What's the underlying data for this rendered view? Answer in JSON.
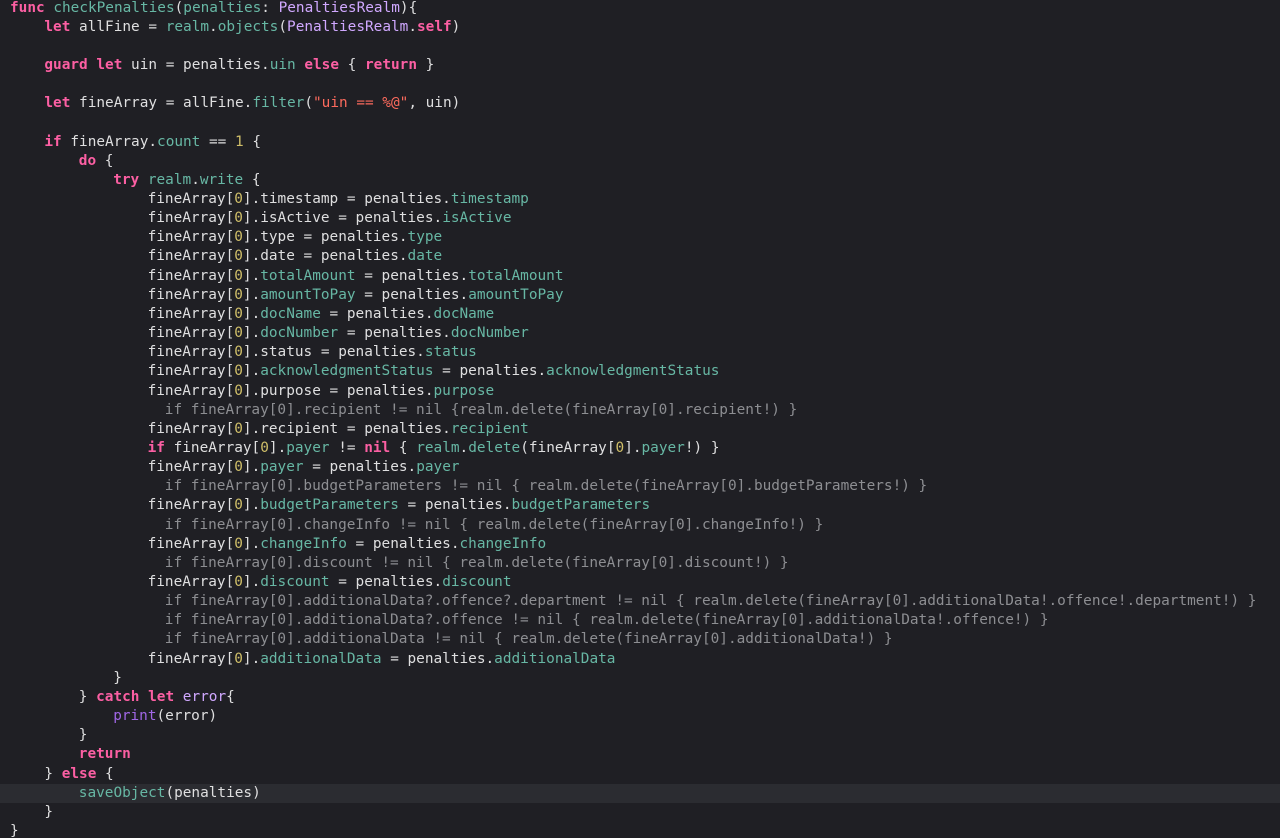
{
  "editor": {
    "theme_colors": {
      "background": "#1f1f24",
      "current_line": "#2b2c31",
      "keyword": "#fc5fa3",
      "method": "#67b7a4",
      "type": "#d0a8ff",
      "string": "#fc6a5d",
      "number": "#d0bf69",
      "plain": "#dfdfe0",
      "builtin": "#a167e6",
      "disabled": "#8d8e92"
    },
    "current_line_index": 41,
    "lines": [
      {
        "indent": 0,
        "tokens": [
          {
            "t": "func",
            "c": "kw"
          },
          {
            "t": " ",
            "c": "pl"
          },
          {
            "t": "checkPenalties",
            "c": "fn"
          },
          {
            "t": "(",
            "c": "pl"
          },
          {
            "t": "penalties",
            "c": "fn"
          },
          {
            "t": ": ",
            "c": "pl"
          },
          {
            "t": "PenaltiesRealm",
            "c": "typ"
          },
          {
            "t": "){",
            "c": "pl"
          }
        ]
      },
      {
        "indent": 4,
        "tokens": [
          {
            "t": "let",
            "c": "kw"
          },
          {
            "t": " allFine = ",
            "c": "pl"
          },
          {
            "t": "realm",
            "c": "prop"
          },
          {
            "t": ".",
            "c": "pl"
          },
          {
            "t": "objects",
            "c": "fn"
          },
          {
            "t": "(",
            "c": "pl"
          },
          {
            "t": "PenaltiesRealm",
            "c": "typ"
          },
          {
            "t": ".",
            "c": "pl"
          },
          {
            "t": "self",
            "c": "kw"
          },
          {
            "t": ")",
            "c": "pl"
          }
        ]
      },
      {
        "indent": 0,
        "tokens": []
      },
      {
        "indent": 4,
        "tokens": [
          {
            "t": "guard",
            "c": "kw"
          },
          {
            "t": " ",
            "c": "pl"
          },
          {
            "t": "let",
            "c": "kw"
          },
          {
            "t": " uin = penalties.",
            "c": "pl"
          },
          {
            "t": "uin",
            "c": "prop"
          },
          {
            "t": " ",
            "c": "pl"
          },
          {
            "t": "else",
            "c": "kw"
          },
          {
            "t": " { ",
            "c": "pl"
          },
          {
            "t": "return",
            "c": "kw"
          },
          {
            "t": " }",
            "c": "pl"
          }
        ]
      },
      {
        "indent": 0,
        "tokens": []
      },
      {
        "indent": 4,
        "tokens": [
          {
            "t": "let",
            "c": "kw"
          },
          {
            "t": " fineArray = allFine.",
            "c": "pl"
          },
          {
            "t": "filter",
            "c": "fn"
          },
          {
            "t": "(",
            "c": "pl"
          },
          {
            "t": "\"uin == %@\"",
            "c": "str"
          },
          {
            "t": ", uin)",
            "c": "pl"
          }
        ]
      },
      {
        "indent": 0,
        "tokens": []
      },
      {
        "indent": 4,
        "tokens": [
          {
            "t": "if",
            "c": "kw"
          },
          {
            "t": " fineArray.",
            "c": "pl"
          },
          {
            "t": "count",
            "c": "prop"
          },
          {
            "t": " == ",
            "c": "pl"
          },
          {
            "t": "1",
            "c": "num"
          },
          {
            "t": " {",
            "c": "pl"
          }
        ]
      },
      {
        "indent": 8,
        "tokens": [
          {
            "t": "do",
            "c": "kw"
          },
          {
            "t": " {",
            "c": "pl"
          }
        ]
      },
      {
        "indent": 12,
        "tokens": [
          {
            "t": "try",
            "c": "kw"
          },
          {
            "t": " ",
            "c": "pl"
          },
          {
            "t": "realm",
            "c": "prop"
          },
          {
            "t": ".",
            "c": "pl"
          },
          {
            "t": "write",
            "c": "fn"
          },
          {
            "t": " {",
            "c": "pl"
          }
        ]
      },
      {
        "indent": 16,
        "tokens": [
          {
            "t": "fineArray[",
            "c": "pl"
          },
          {
            "t": "0",
            "c": "num"
          },
          {
            "t": "].timestamp = penalties.",
            "c": "pl"
          },
          {
            "t": "timestamp",
            "c": "prop"
          }
        ]
      },
      {
        "indent": 16,
        "tokens": [
          {
            "t": "fineArray[",
            "c": "pl"
          },
          {
            "t": "0",
            "c": "num"
          },
          {
            "t": "].isActive = penalties.",
            "c": "pl"
          },
          {
            "t": "isActive",
            "c": "prop"
          }
        ]
      },
      {
        "indent": 16,
        "tokens": [
          {
            "t": "fineArray[",
            "c": "pl"
          },
          {
            "t": "0",
            "c": "num"
          },
          {
            "t": "].type = penalties.",
            "c": "pl"
          },
          {
            "t": "type",
            "c": "prop"
          }
        ]
      },
      {
        "indent": 16,
        "tokens": [
          {
            "t": "fineArray[",
            "c": "pl"
          },
          {
            "t": "0",
            "c": "num"
          },
          {
            "t": "].date = penalties.",
            "c": "pl"
          },
          {
            "t": "date",
            "c": "prop"
          }
        ]
      },
      {
        "indent": 16,
        "tokens": [
          {
            "t": "fineArray[",
            "c": "pl"
          },
          {
            "t": "0",
            "c": "num"
          },
          {
            "t": "].",
            "c": "pl"
          },
          {
            "t": "totalAmount",
            "c": "prop"
          },
          {
            "t": " = penalties.",
            "c": "pl"
          },
          {
            "t": "totalAmount",
            "c": "prop"
          }
        ]
      },
      {
        "indent": 16,
        "tokens": [
          {
            "t": "fineArray[",
            "c": "pl"
          },
          {
            "t": "0",
            "c": "num"
          },
          {
            "t": "].",
            "c": "pl"
          },
          {
            "t": "amountToPay",
            "c": "prop"
          },
          {
            "t": " = penalties.",
            "c": "pl"
          },
          {
            "t": "amountToPay",
            "c": "prop"
          }
        ]
      },
      {
        "indent": 16,
        "tokens": [
          {
            "t": "fineArray[",
            "c": "pl"
          },
          {
            "t": "0",
            "c": "num"
          },
          {
            "t": "].",
            "c": "pl"
          },
          {
            "t": "docName",
            "c": "prop"
          },
          {
            "t": " = penalties.",
            "c": "pl"
          },
          {
            "t": "docName",
            "c": "prop"
          }
        ]
      },
      {
        "indent": 16,
        "tokens": [
          {
            "t": "fineArray[",
            "c": "pl"
          },
          {
            "t": "0",
            "c": "num"
          },
          {
            "t": "].",
            "c": "pl"
          },
          {
            "t": "docNumber",
            "c": "prop"
          },
          {
            "t": " = penalties.",
            "c": "pl"
          },
          {
            "t": "docNumber",
            "c": "prop"
          }
        ]
      },
      {
        "indent": 16,
        "tokens": [
          {
            "t": "fineArray[",
            "c": "pl"
          },
          {
            "t": "0",
            "c": "num"
          },
          {
            "t": "].status = penalties.",
            "c": "pl"
          },
          {
            "t": "status",
            "c": "prop"
          }
        ]
      },
      {
        "indent": 16,
        "tokens": [
          {
            "t": "fineArray[",
            "c": "pl"
          },
          {
            "t": "0",
            "c": "num"
          },
          {
            "t": "].",
            "c": "pl"
          },
          {
            "t": "acknowledgmentStatus",
            "c": "prop"
          },
          {
            "t": " = penalties.",
            "c": "pl"
          },
          {
            "t": "acknowledgmentStatus",
            "c": "prop"
          }
        ]
      },
      {
        "indent": 16,
        "tokens": [
          {
            "t": "fineArray[",
            "c": "pl"
          },
          {
            "t": "0",
            "c": "num"
          },
          {
            "t": "].purpose = penalties.",
            "c": "pl"
          },
          {
            "t": "purpose",
            "c": "prop"
          }
        ]
      },
      {
        "indent": 18,
        "tokens": [
          {
            "t": "if fineArray[0].recipient != nil {realm.delete(fineArray[0].recipient!) }",
            "c": "dim"
          }
        ]
      },
      {
        "indent": 16,
        "tokens": [
          {
            "t": "fineArray[",
            "c": "pl"
          },
          {
            "t": "0",
            "c": "num"
          },
          {
            "t": "].recipient = penalties.",
            "c": "pl"
          },
          {
            "t": "recipient",
            "c": "prop"
          }
        ]
      },
      {
        "indent": 16,
        "tokens": [
          {
            "t": "if",
            "c": "kw"
          },
          {
            "t": " fineArray[",
            "c": "pl"
          },
          {
            "t": "0",
            "c": "num"
          },
          {
            "t": "].",
            "c": "pl"
          },
          {
            "t": "payer",
            "c": "prop"
          },
          {
            "t": " != ",
            "c": "pl"
          },
          {
            "t": "nil",
            "c": "kw"
          },
          {
            "t": " { ",
            "c": "pl"
          },
          {
            "t": "realm",
            "c": "prop"
          },
          {
            "t": ".",
            "c": "pl"
          },
          {
            "t": "delete",
            "c": "fn"
          },
          {
            "t": "(fineArray[",
            "c": "pl"
          },
          {
            "t": "0",
            "c": "num"
          },
          {
            "t": "].",
            "c": "pl"
          },
          {
            "t": "payer",
            "c": "prop"
          },
          {
            "t": "!) }",
            "c": "pl"
          }
        ]
      },
      {
        "indent": 16,
        "tokens": [
          {
            "t": "fineArray[",
            "c": "pl"
          },
          {
            "t": "0",
            "c": "num"
          },
          {
            "t": "].",
            "c": "pl"
          },
          {
            "t": "payer",
            "c": "prop"
          },
          {
            "t": " = penalties.",
            "c": "pl"
          },
          {
            "t": "payer",
            "c": "prop"
          }
        ]
      },
      {
        "indent": 18,
        "tokens": [
          {
            "t": "if fineArray[0].budgetParameters != nil { realm.delete(fineArray[0].budgetParameters!) }",
            "c": "dim"
          }
        ]
      },
      {
        "indent": 16,
        "tokens": [
          {
            "t": "fineArray[",
            "c": "pl"
          },
          {
            "t": "0",
            "c": "num"
          },
          {
            "t": "].",
            "c": "pl"
          },
          {
            "t": "budgetParameters",
            "c": "prop"
          },
          {
            "t": " = penalties.",
            "c": "pl"
          },
          {
            "t": "budgetParameters",
            "c": "prop"
          }
        ]
      },
      {
        "indent": 18,
        "tokens": [
          {
            "t": "if fineArray[0].changeInfo != nil { realm.delete(fineArray[0].changeInfo!) }",
            "c": "dim"
          }
        ]
      },
      {
        "indent": 16,
        "tokens": [
          {
            "t": "fineArray[",
            "c": "pl"
          },
          {
            "t": "0",
            "c": "num"
          },
          {
            "t": "].",
            "c": "pl"
          },
          {
            "t": "changeInfo",
            "c": "prop"
          },
          {
            "t": " = penalties.",
            "c": "pl"
          },
          {
            "t": "changeInfo",
            "c": "prop"
          }
        ]
      },
      {
        "indent": 18,
        "tokens": [
          {
            "t": "if fineArray[0].discount != nil { realm.delete(fineArray[0].discount!) }",
            "c": "dim"
          }
        ]
      },
      {
        "indent": 16,
        "tokens": [
          {
            "t": "fineArray[",
            "c": "pl"
          },
          {
            "t": "0",
            "c": "num"
          },
          {
            "t": "].",
            "c": "pl"
          },
          {
            "t": "discount",
            "c": "prop"
          },
          {
            "t": " = penalties.",
            "c": "pl"
          },
          {
            "t": "discount",
            "c": "prop"
          }
        ]
      },
      {
        "indent": 18,
        "tokens": [
          {
            "t": "if fineArray[0].additionalData?.offence?.department != nil { realm.delete(fineArray[0].additionalData!.offence!.department!) }",
            "c": "dim"
          }
        ]
      },
      {
        "indent": 18,
        "tokens": [
          {
            "t": "if fineArray[0].additionalData?.offence != nil { realm.delete(fineArray[0].additionalData!.offence!) }",
            "c": "dim"
          }
        ]
      },
      {
        "indent": 18,
        "tokens": [
          {
            "t": "if fineArray[0].additionalData != nil { realm.delete(fineArray[0].additionalData!) }",
            "c": "dim"
          }
        ]
      },
      {
        "indent": 16,
        "tokens": [
          {
            "t": "fineArray[",
            "c": "pl"
          },
          {
            "t": "0",
            "c": "num"
          },
          {
            "t": "].",
            "c": "pl"
          },
          {
            "t": "additionalData",
            "c": "prop"
          },
          {
            "t": " = penalties.",
            "c": "pl"
          },
          {
            "t": "additionalData",
            "c": "prop"
          }
        ]
      },
      {
        "indent": 12,
        "tokens": [
          {
            "t": "}",
            "c": "pl"
          }
        ]
      },
      {
        "indent": 8,
        "tokens": [
          {
            "t": "} ",
            "c": "pl"
          },
          {
            "t": "catch",
            "c": "kw"
          },
          {
            "t": " ",
            "c": "pl"
          },
          {
            "t": "let",
            "c": "kw"
          },
          {
            "t": " ",
            "c": "pl"
          },
          {
            "t": "error",
            "c": "typ"
          },
          {
            "t": "{",
            "c": "pl"
          }
        ]
      },
      {
        "indent": 12,
        "tokens": [
          {
            "t": "print",
            "c": "prn"
          },
          {
            "t": "(error)",
            "c": "pl"
          }
        ]
      },
      {
        "indent": 8,
        "tokens": [
          {
            "t": "}",
            "c": "pl"
          }
        ]
      },
      {
        "indent": 8,
        "tokens": [
          {
            "t": "return",
            "c": "kw"
          }
        ]
      },
      {
        "indent": 4,
        "tokens": [
          {
            "t": "} ",
            "c": "pl"
          },
          {
            "t": "else",
            "c": "kw"
          },
          {
            "t": " {",
            "c": "pl"
          }
        ]
      },
      {
        "indent": 8,
        "tokens": [
          {
            "t": "saveObject",
            "c": "fn"
          },
          {
            "t": "(penalties)",
            "c": "pl"
          }
        ]
      },
      {
        "indent": 4,
        "tokens": [
          {
            "t": "}",
            "c": "pl"
          }
        ]
      },
      {
        "indent": 0,
        "tokens": [
          {
            "t": "}",
            "c": "pl"
          }
        ]
      }
    ]
  }
}
